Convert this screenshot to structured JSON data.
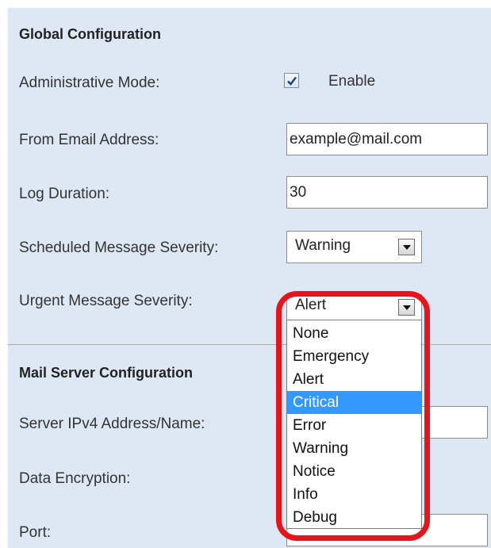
{
  "global_section": {
    "title": "Global Configuration"
  },
  "admin_mode": {
    "label": "Administrative Mode:",
    "checked": true,
    "checkbox_label": "Enable"
  },
  "from_email": {
    "label": "From Email Address:",
    "value": "example@mail.com"
  },
  "log_duration": {
    "label": "Log Duration:",
    "value": "30"
  },
  "scheduled_severity": {
    "label": "Scheduled Message Severity:",
    "value": "Warning"
  },
  "urgent_severity": {
    "label": "Urgent Message Severity:",
    "value": "Alert",
    "options": [
      "None",
      "Emergency",
      "Alert",
      "Critical",
      "Error",
      "Warning",
      "Notice",
      "Info",
      "Debug"
    ],
    "highlighted_option": "Critical"
  },
  "mail_section": {
    "title": "Mail Server Configuration"
  },
  "server_address": {
    "label": "Server IPv4 Address/Name:"
  },
  "data_encryption": {
    "label": "Data Encryption:"
  },
  "port": {
    "label": "Port:"
  },
  "colors": {
    "panel_background": "#dde8f4",
    "selection_highlight": "#3399ff",
    "annotation_ring": "#e8141b"
  },
  "icons": {
    "checkbox_check": "check-icon",
    "select_arrow": "chevron-down-icon"
  }
}
